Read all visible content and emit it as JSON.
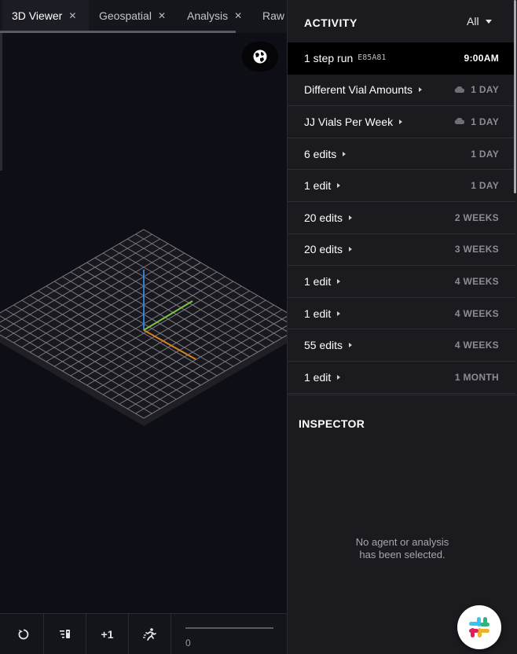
{
  "tabs": [
    {
      "label": "3D Viewer",
      "active": true
    },
    {
      "label": "Geospatial",
      "active": false
    },
    {
      "label": "Analysis",
      "active": false
    },
    {
      "label": "Raw",
      "active": false
    }
  ],
  "toolbar": {
    "step_label": "+1",
    "timeline_value": "0"
  },
  "activity": {
    "title": "ACTIVITY",
    "filter": "All",
    "items": [
      {
        "label": "1 step run",
        "code": "E85A81",
        "time": "9:00AM",
        "cloud": false,
        "arrow": false
      },
      {
        "label": "Different Vial Amounts",
        "code": "",
        "time": "1 DAY",
        "cloud": true,
        "arrow": true
      },
      {
        "label": "JJ Vials Per Week",
        "code": "",
        "time": "1 DAY",
        "cloud": true,
        "arrow": true
      },
      {
        "label": "6 edits",
        "code": "",
        "time": "1 DAY",
        "cloud": false,
        "arrow": true
      },
      {
        "label": "1 edit",
        "code": "",
        "time": "1 DAY",
        "cloud": false,
        "arrow": true
      },
      {
        "label": "20 edits",
        "code": "",
        "time": "2 WEEKS",
        "cloud": false,
        "arrow": true
      },
      {
        "label": "20 edits",
        "code": "",
        "time": "3 WEEKS",
        "cloud": false,
        "arrow": true
      },
      {
        "label": "1 edit",
        "code": "",
        "time": "4 WEEKS",
        "cloud": false,
        "arrow": true
      },
      {
        "label": "1 edit",
        "code": "",
        "time": "4 WEEKS",
        "cloud": false,
        "arrow": true
      },
      {
        "label": "55 edits",
        "code": "",
        "time": "4 WEEKS",
        "cloud": false,
        "arrow": true
      },
      {
        "label": "1 edit",
        "code": "",
        "time": "1 MONTH",
        "cloud": false,
        "arrow": true
      }
    ]
  },
  "inspector": {
    "title": "INSPECTOR",
    "empty_line1": "No agent or analysis",
    "empty_line2": "has been selected."
  },
  "colors": {
    "axis_y": "#2f7fd6",
    "axis_x": "#7ec63a",
    "axis_z": "#d9821f",
    "grid": "#7a7a80"
  }
}
